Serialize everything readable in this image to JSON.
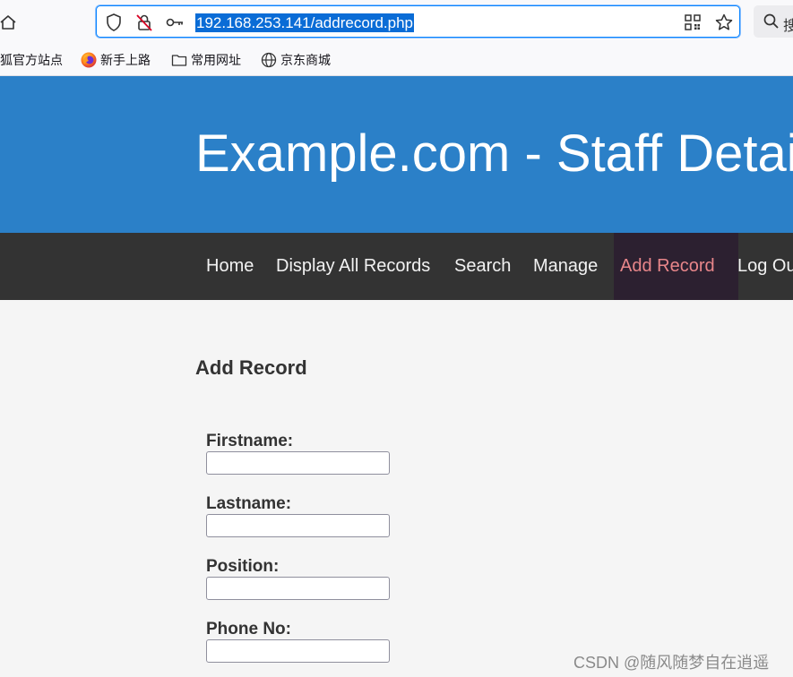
{
  "browser": {
    "url": "192.168.253.141/addrecord.php",
    "search_placeholder": "搜",
    "bookmarks": [
      {
        "label": "狐官方站点",
        "icon": "firefox-page-icon"
      },
      {
        "label": "新手上路",
        "icon": "firefox-logo-icon"
      },
      {
        "label": "常用网址",
        "icon": "folder-icon"
      },
      {
        "label": "京东商城",
        "icon": "globe-icon"
      }
    ]
  },
  "site": {
    "title": "Example.com - Staff Details",
    "nav": [
      {
        "label": "Home"
      },
      {
        "label": "Display All Records"
      },
      {
        "label": "Search"
      },
      {
        "label": "Manage"
      },
      {
        "label": "Add Record",
        "active": true
      },
      {
        "label": "Log Out"
      }
    ],
    "colors": {
      "header": "#2b80c8",
      "nav": "#333333",
      "active_link": "#e8868a"
    }
  },
  "form": {
    "heading": "Add Record",
    "fields": [
      {
        "label": "Firstname:",
        "value": ""
      },
      {
        "label": "Lastname:",
        "value": ""
      },
      {
        "label": "Position:",
        "value": ""
      },
      {
        "label": "Phone No:",
        "value": ""
      }
    ]
  },
  "watermark": "CSDN @随风随梦自在逍遥"
}
